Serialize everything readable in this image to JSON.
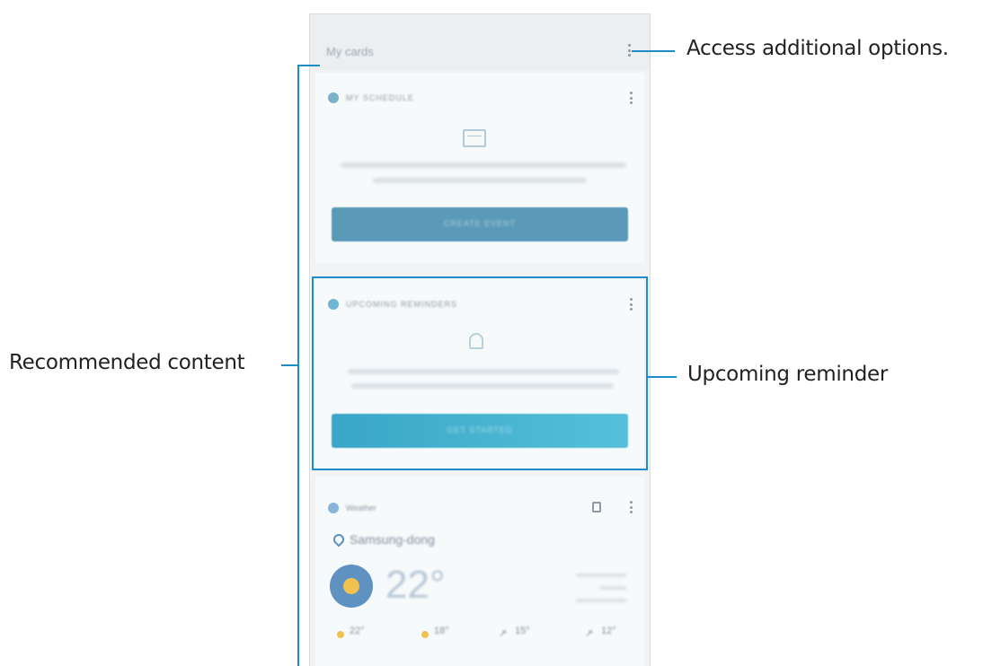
{
  "screen": {
    "header_title": "My cards"
  },
  "cards": {
    "schedule": {
      "title": "MY SCHEDULE",
      "button_label": "CREATE EVENT"
    },
    "reminder": {
      "title": "UPCOMING REMINDERS",
      "button_label": "GET STARTED"
    },
    "weather": {
      "title": "Weather",
      "location": "Samsung-dong",
      "temperature": "22°",
      "forecast": [
        {
          "temp": "22°",
          "icon": "sun-icon"
        },
        {
          "temp": "18°",
          "icon": "sun-icon"
        },
        {
          "temp": "15°",
          "icon": "wind-icon"
        },
        {
          "temp": "12°",
          "icon": "wind-icon"
        }
      ]
    }
  },
  "callouts": {
    "options": "Access additional options.",
    "recommended": "Recommended content",
    "reminder": "Upcoming reminder"
  },
  "colors": {
    "callout_line": "#1b8ec9",
    "schedule_button": "#5a9ab8",
    "reminder_button": "#3fb0cf"
  }
}
